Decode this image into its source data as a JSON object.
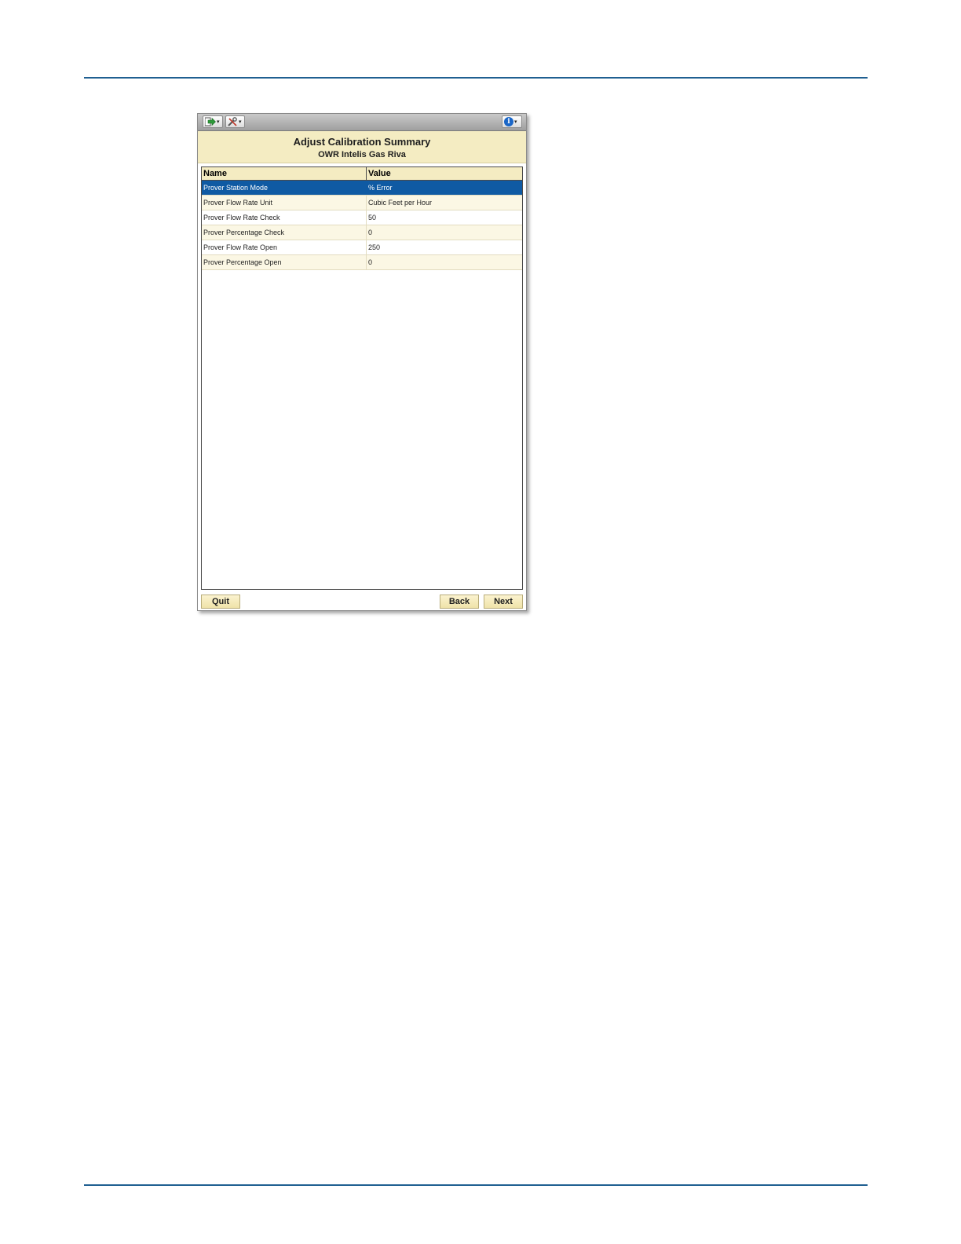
{
  "window": {
    "title": "Adjust Calibration Summary",
    "subtitle": "OWR Intelis Gas Riva"
  },
  "toolbar": {
    "nav_icon": "navigation-arrow-icon",
    "tools_icon": "tools-icon",
    "info_icon": "info-icon",
    "info_glyph": "i",
    "caret": "▾"
  },
  "grid": {
    "columns": [
      "Name",
      "Value"
    ],
    "rows": [
      {
        "name": "Prover Station Mode",
        "value": "% Error"
      },
      {
        "name": "Prover Flow Rate Unit",
        "value": "Cubic Feet per Hour"
      },
      {
        "name": "Prover Flow Rate Check",
        "value": "50"
      },
      {
        "name": "Prover Percentage Check",
        "value": "0"
      },
      {
        "name": "Prover Flow Rate Open",
        "value": "250"
      },
      {
        "name": "Prover Percentage Open",
        "value": "0"
      }
    ],
    "selected_row": 0
  },
  "buttons": {
    "quit": "Quit",
    "back": "Back",
    "next": "Next"
  },
  "colors": {
    "header_bg": "#f4ecc2",
    "selection": "#0f5aa3",
    "page_rule": "#1f5f91"
  }
}
